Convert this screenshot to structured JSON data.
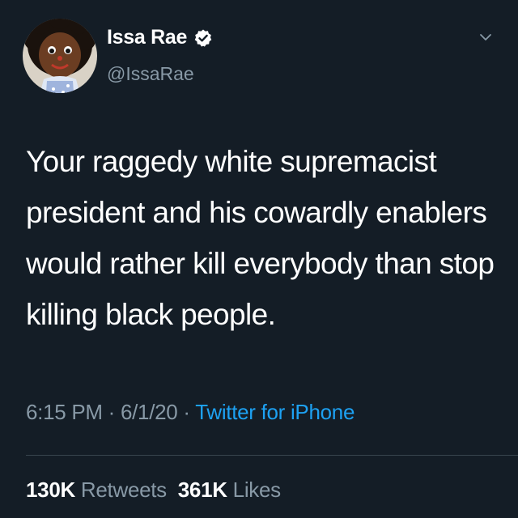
{
  "colors": {
    "background": "#141d26",
    "primary_text": "#ffffff",
    "secondary_text": "#8899a6",
    "link": "#1da1f2",
    "divider": "#38444d"
  },
  "author": {
    "display_name": "Issa Rae",
    "handle": "@IssaRae",
    "verified_icon": "verified-badge-icon",
    "avatar_icon": "doll-avatar"
  },
  "menu_icon": "chevron-down-icon",
  "tweet": {
    "text": "Your raggedy white supremacist\npresident and his cowardly enablers\nwould rather kill everybody than stop\nkilling black people."
  },
  "meta": {
    "time": "6:15 PM",
    "separator1": " · ",
    "date": "6/1/20",
    "separator2": " · ",
    "source": "Twitter for iPhone"
  },
  "stats": {
    "retweets_count": "130K",
    "retweets_label": "Retweets",
    "likes_count": "361K",
    "likes_label": "Likes"
  }
}
